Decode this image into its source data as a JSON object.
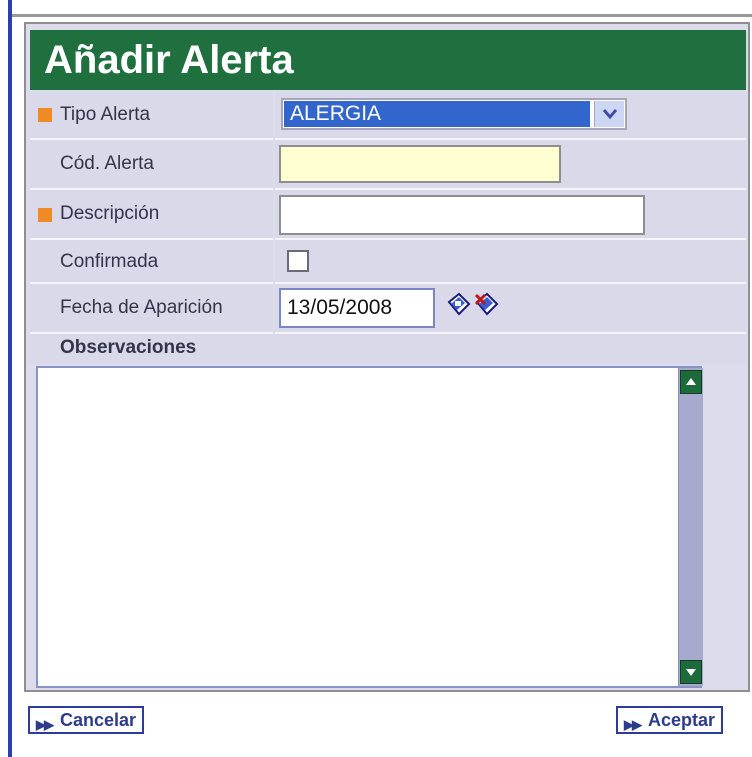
{
  "form": {
    "title": "Añadir Alerta",
    "fields": {
      "tipo_alerta": {
        "label": "Tipo Alerta",
        "value": "ALERGIA",
        "required": true
      },
      "cod_alerta": {
        "label": "Cód. Alerta",
        "value": ""
      },
      "descripcion": {
        "label": "Descripción",
        "value": "",
        "required": true
      },
      "confirmada": {
        "label": "Confirmada",
        "checked": false
      },
      "fecha_aparicion": {
        "label": "Fecha de Aparición",
        "value": "13/05/2008"
      },
      "observaciones": {
        "label": "Observaciones",
        "value": ""
      }
    }
  },
  "buttons": {
    "cancel_label": "Cancelar",
    "accept_label": "Aceptar"
  },
  "icons": {
    "dropdown": "chevron-down-icon",
    "calendar": "calendar-icon",
    "clear_date": "calendar-clear-icon",
    "required_marker": "required-marker-icon",
    "scroll_up": "scroll-up-icon",
    "scroll_down": "scroll-down-icon",
    "button_arrows": "double-arrow-right-icon"
  },
  "colors": {
    "title_bar": "#1f6f3f",
    "required_marker": "#f08a24",
    "selected_option": "#3366cc",
    "code_field_bg": "#ffffd2",
    "form_bg": "#dcdcec"
  }
}
